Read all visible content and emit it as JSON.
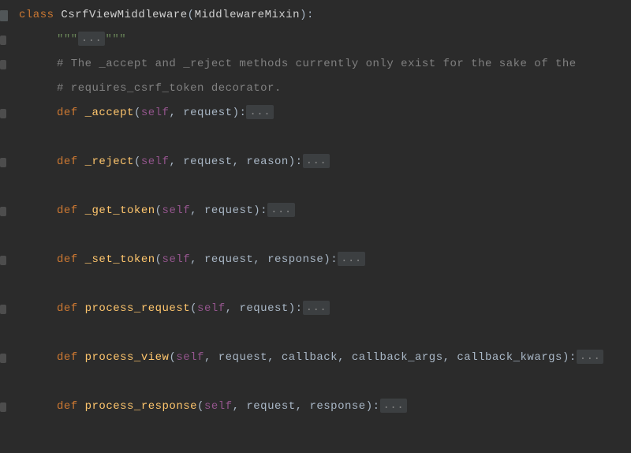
{
  "lines": {
    "l0": {
      "kw_class": "class",
      "classname": " CsrfViewMiddleware",
      "paren_open": "(",
      "base": "MiddlewareMixin",
      "paren_close": "):"
    },
    "l1": {
      "docstring_open": "\"\"\"",
      "docstring_fold": "...",
      "docstring_close": "\"\"\""
    },
    "l2": {
      "comment": "# The _accept and _reject methods currently only exist for the sake of the"
    },
    "l3": {
      "comment": "# requires_csrf_token decorator."
    },
    "l4": {
      "kw_def": "def",
      "fn": " _accept",
      "sig_open": "(",
      "self": "self",
      "params": ", request",
      "sig_close": "):",
      "fold": "..."
    },
    "l6": {
      "kw_def": "def",
      "fn": " _reject",
      "sig_open": "(",
      "self": "self",
      "params": ", request, reason",
      "sig_close": "):",
      "fold": "..."
    },
    "l8": {
      "kw_def": "def",
      "fn": " _get_token",
      "sig_open": "(",
      "self": "self",
      "params": ", request",
      "sig_close": "):",
      "fold": "..."
    },
    "l10": {
      "kw_def": "def",
      "fn": " _set_token",
      "sig_open": "(",
      "self": "self",
      "params": ", request, response",
      "sig_close": "):",
      "fold": "..."
    },
    "l12": {
      "kw_def": "def",
      "fn": " process_request",
      "sig_open": "(",
      "self": "self",
      "params": ", request",
      "sig_close": "):",
      "fold": "..."
    },
    "l14": {
      "kw_def": "def",
      "fn": " process_view",
      "sig_open": "(",
      "self": "self",
      "params": ", request, callback, callback_args, callback_kwargs",
      "sig_close": "):",
      "fold": "..."
    },
    "l16": {
      "kw_def": "def",
      "fn": " process_response",
      "sig_open": "(",
      "self": "self",
      "params": ", request, response",
      "sig_close": "):",
      "fold": "..."
    }
  }
}
